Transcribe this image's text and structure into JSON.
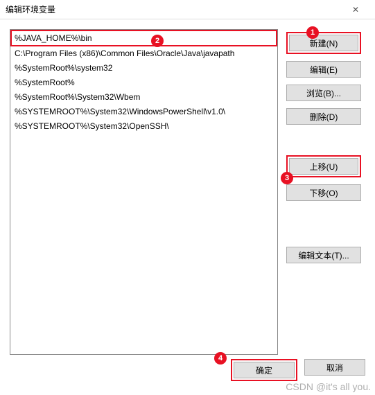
{
  "window": {
    "title": "编辑环境变量",
    "close": "✕"
  },
  "list": {
    "items": [
      "%JAVA_HOME%\\bin",
      "C:\\Program Files (x86)\\Common Files\\Oracle\\Java\\javapath",
      "%SystemRoot%\\system32",
      "%SystemRoot%",
      "%SystemRoot%\\System32\\Wbem",
      "%SYSTEMROOT%\\System32\\WindowsPowerShell\\v1.0\\",
      "%SYSTEMROOT%\\System32\\OpenSSH\\"
    ],
    "selected_index": 0
  },
  "buttons": {
    "new": "新建(N)",
    "edit": "编辑(E)",
    "browse": "浏览(B)...",
    "delete": "删除(D)",
    "move_up": "上移(U)",
    "move_down": "下移(O)",
    "edit_text": "编辑文本(T)...",
    "ok": "确定",
    "cancel": "取消"
  },
  "callouts": {
    "c1": "1",
    "c2": "2",
    "c3": "3",
    "c4": "4"
  },
  "watermark": "CSDN @it's all you.",
  "colors": {
    "highlight": "#e81123"
  }
}
